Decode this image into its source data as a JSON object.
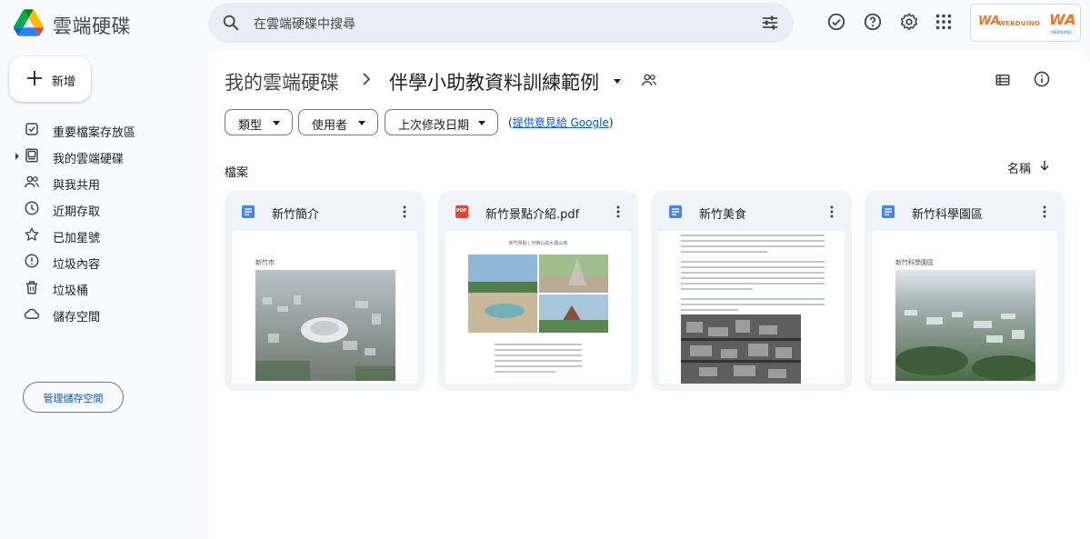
{
  "header": {
    "brand": "雲端硬碟",
    "search_placeholder": "在雲端硬碟中搜尋",
    "account": {
      "logo_text_1": "WA",
      "logo_text_2": "WEBDUINO",
      "logo_text_3": "WA",
      "logo_text_4": "WEBDUINO"
    }
  },
  "sidebar": {
    "new_label": "新增",
    "items": [
      {
        "label": "重要檔案存放區",
        "icon": "priority-icon"
      },
      {
        "label": "我的雲端硬碟",
        "icon": "my-drive-icon"
      },
      {
        "label": "與我共用",
        "icon": "shared-icon"
      },
      {
        "label": "近期存取",
        "icon": "recent-icon"
      },
      {
        "label": "已加星號",
        "icon": "star-icon"
      },
      {
        "label": "垃圾內容",
        "icon": "spam-icon"
      },
      {
        "label": "垃圾桶",
        "icon": "trash-icon"
      },
      {
        "label": "儲存空間",
        "icon": "cloud-icon"
      }
    ],
    "storage_button": "管理儲存空間"
  },
  "main": {
    "breadcrumb_root": "我的雲端硬碟",
    "breadcrumb_current": "伴學小助教資料訓練範例",
    "filters": [
      "類型",
      "使用者",
      "上次修改日期"
    ],
    "feedback_prefix": "(",
    "feedback_link": "提供意見給 Google",
    "feedback_suffix": ")",
    "section_title": "檔案",
    "sort_label": "名稱",
    "files": [
      {
        "name": "新竹簡介",
        "type": "doc",
        "thumb_title": "新竹市"
      },
      {
        "name": "新竹景點介紹.pdf",
        "type": "pdf",
        "pdf_badge": "PDF",
        "thumb_title": "新竹景點 | 可御山莊水露山館"
      },
      {
        "name": "新竹美食",
        "type": "doc"
      },
      {
        "name": "新竹科學園區",
        "type": "doc",
        "thumb_title": "新竹科學園區"
      }
    ]
  },
  "colors": {
    "accent": "#0b57d0",
    "doc_blue": "#4285f4",
    "pdf_red": "#ea4335",
    "panel_bg": "#f8fafd",
    "card_bg": "#f0f4f9"
  }
}
